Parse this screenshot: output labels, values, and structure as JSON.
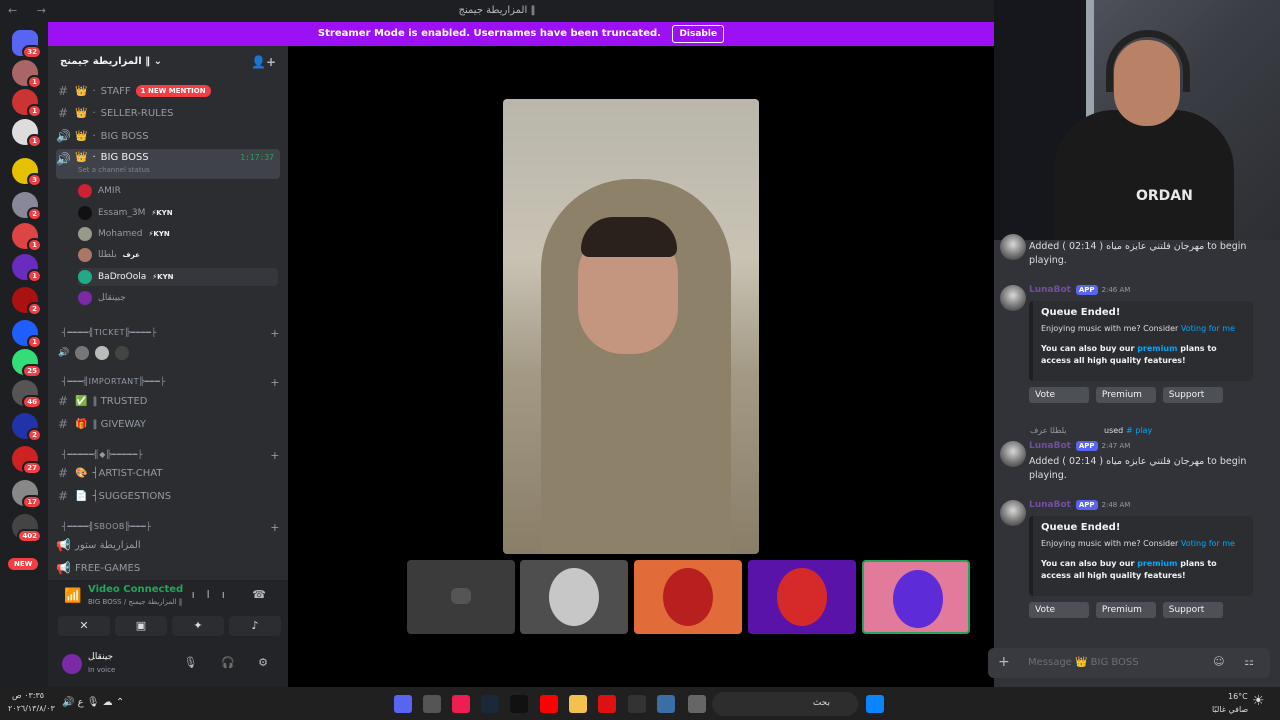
{
  "window": {
    "title": "ال‍م‍زاري‍ط‍ة ج‍ي‍م‍ن‍ج ‖"
  },
  "streamer_banner": {
    "text": "Streamer Mode is enabled. Usernames have been truncated.",
    "button": "Disable"
  },
  "server": {
    "name": "ال‍م‍زاري‍ط‍ة ج‍ي‍م‍ن‍ج ‖",
    "badges": [
      "32",
      "1",
      "1",
      "1",
      "3",
      "2",
      "1",
      "1",
      "2",
      "1",
      "25",
      "46",
      "2",
      "27",
      "17",
      "402"
    ],
    "new_label": "NEW"
  },
  "channels": [
    {
      "name": "STAFF",
      "mention": "1 NEW MENTION"
    },
    {
      "name": "SELLER-RULES"
    },
    {
      "name": "BIG BOSS"
    },
    {
      "name": "BIG BOSS",
      "timer": "1:17:37",
      "status": "Set a channel status"
    }
  ],
  "voice_users": [
    {
      "name": "AMIR",
      "tag": ""
    },
    {
      "name": "Essam_3M",
      "tag": "⚡KYN"
    },
    {
      "name": "Mohamed",
      "tag": "⚡KYN"
    },
    {
      "name": "ب‍ل‍ط‍ل‍ا",
      "tag": "عرف"
    },
    {
      "name": "BaDroOola",
      "tag": "⚡KYN"
    },
    {
      "name": "ج‍ب‍ي‍ن‍ق‍ا‍ل",
      "tag": ""
    }
  ],
  "categories": [
    {
      "name": "┤━━━━╣TICKET╠━━━━├"
    },
    {
      "name": "┤━━━╣IMPORTANT╠━━━├"
    },
    {
      "name": "┤━━━━━╣◆╠━━━━━├"
    },
    {
      "name": "┤━━━━╣SBOOB╠━━━├"
    }
  ],
  "channels2": [
    {
      "name": "‖ TRUSTED"
    },
    {
      "name": "‖ GIVEWAY"
    },
    {
      "name": "┤ARTIST-CHAT"
    },
    {
      "name": "┤SUGGESTIONS"
    },
    {
      "name": "ال‍م‍زاري‍ط‍ة س‍ت‍ور"
    },
    {
      "name": "FREE-GAMES"
    }
  ],
  "voice_panel": {
    "title": "Video Connected",
    "sub": "BIG BOSS / ال‍م‍زاري‍ط‍ة ج‍ي‍م‍ن‍ج ‖"
  },
  "user_panel": {
    "name": "ج‍ي‍ن‍ق‍ا‍ل",
    "status": "In voice"
  },
  "chat": {
    "messages": [
      {
        "type": "text",
        "text": "Added ( 02:14 ) مهرجان فلتني عايزه مياه to begin playing."
      },
      {
        "type": "embed",
        "author": "LunaBot",
        "app": "APP",
        "time": "2:46 AM",
        "title": "Queue Ended!",
        "line1": "Enjoying music with me? Consider",
        "link1": "Voting for me",
        "line2a": "You can also buy our",
        "link2": "premium",
        "line2b": "plans to access all high quality features!",
        "buttons": [
          "Vote",
          "Premium",
          "Support"
        ]
      },
      {
        "type": "used",
        "user": "ب‍ل‍ط‍ل‍ا عرف",
        "used": "used",
        "cmd": "play"
      },
      {
        "type": "bot_text",
        "author": "LunaBot",
        "app": "APP",
        "time": "2:47 AM",
        "text": "Added ( 02:14 ) مهرجان فلتني عايزه مياه to begin playing."
      },
      {
        "type": "embed",
        "author": "LunaBot",
        "app": "APP",
        "time": "2:48 AM",
        "title": "Queue Ended!",
        "line1": "Enjoying music with me? Consider",
        "link1": "Voting for me",
        "line2a": "You can also buy our",
        "link2": "premium",
        "line2b": "plans to access all high quality features!",
        "buttons": [
          "Vote",
          "Premium",
          "Support"
        ]
      }
    ],
    "composer_placeholder": "Message 👑 BIG BOSS"
  },
  "webcam": {
    "shirt_text": "ORDAN"
  },
  "taskbar": {
    "time": "٠٣:٣٥ ص",
    "date": "٢٠٢٦/١٣/٨/٠٣",
    "search": "بحث",
    "weather_temp": "16°C",
    "weather_desc": "صافي غالبًا"
  }
}
